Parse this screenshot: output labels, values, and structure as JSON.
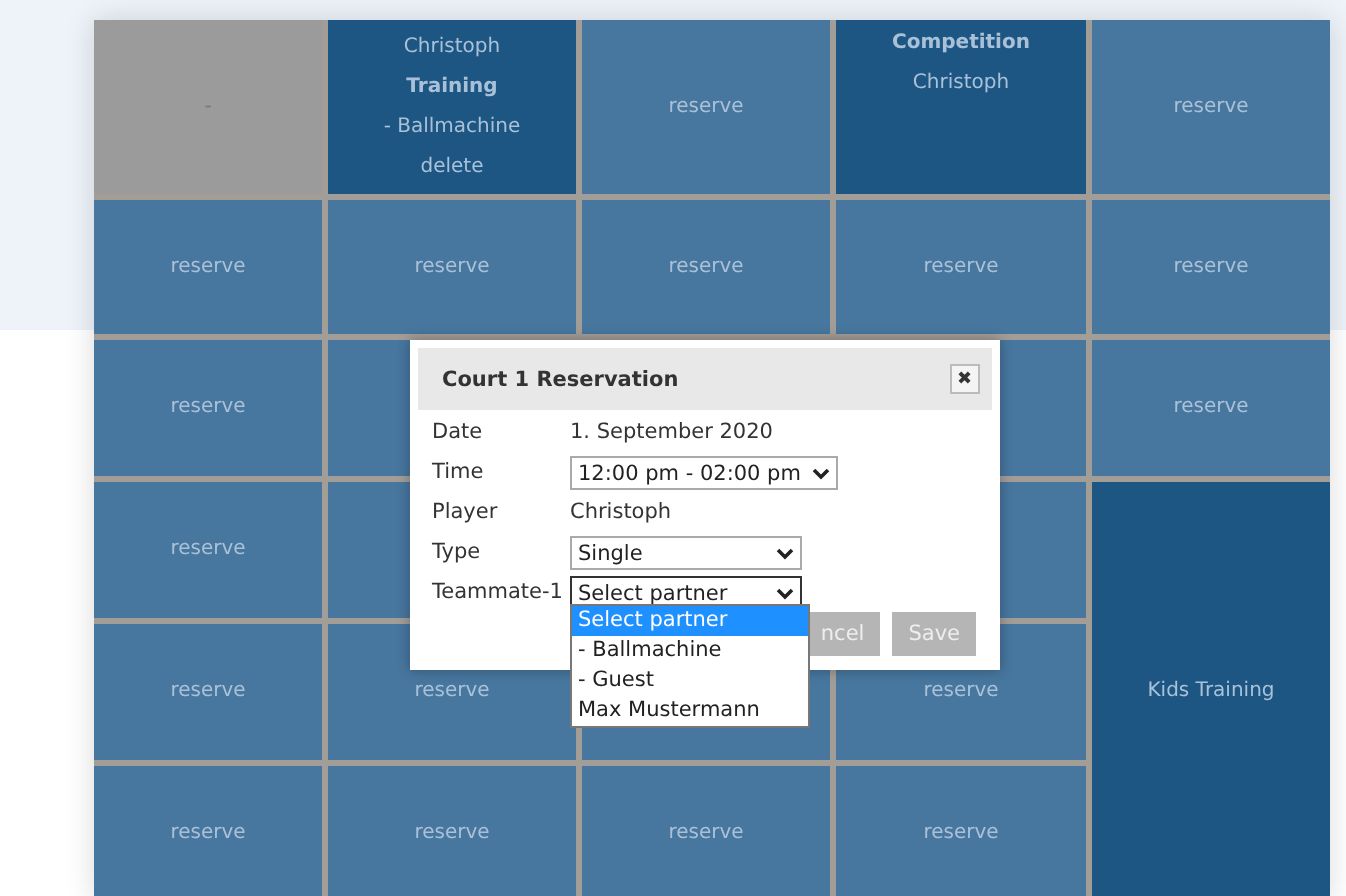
{
  "schedule": {
    "rows": [
      {
        "cells": [
          {
            "kind": "blocked",
            "lines": [
              "-"
            ]
          },
          {
            "kind": "booking",
            "lines": [
              "Christoph",
              "**Training**",
              "- Ballmachine",
              "delete"
            ]
          },
          {
            "kind": "free",
            "lines": [
              "reserve"
            ]
          },
          {
            "kind": "booking",
            "top_aligned": true,
            "lines": [
              "**Competition**",
              "Christoph"
            ]
          },
          {
            "kind": "free",
            "lines": [
              "reserve"
            ]
          }
        ]
      },
      {
        "cells": [
          {
            "kind": "free",
            "lines": [
              "reserve"
            ]
          },
          {
            "kind": "free",
            "lines": [
              "reserve"
            ]
          },
          {
            "kind": "free",
            "lines": [
              "reserve"
            ]
          },
          {
            "kind": "free",
            "lines": [
              "reserve"
            ]
          },
          {
            "kind": "free",
            "lines": [
              "reserve"
            ]
          }
        ]
      },
      {
        "cells": [
          {
            "kind": "free",
            "lines": [
              "reserve"
            ]
          },
          {
            "kind": "free"
          },
          null,
          {
            "kind": "free"
          },
          {
            "kind": "free",
            "lines": [
              "reserve"
            ]
          }
        ]
      },
      {
        "cells": [
          {
            "kind": "free",
            "lines": [
              "reserve"
            ]
          },
          {
            "kind": "free"
          },
          null,
          {
            "kind": "free"
          },
          {
            "kind": "booking",
            "rowspan": 3,
            "lines": [
              "Kids Training"
            ]
          }
        ]
      },
      {
        "cells": [
          {
            "kind": "free",
            "lines": [
              "reserve"
            ]
          },
          {
            "kind": "free",
            "lines": [
              "reserve"
            ]
          },
          {
            "kind": "free"
          },
          {
            "kind": "free",
            "lines": [
              "reserve"
            ]
          }
        ]
      },
      {
        "cells": [
          {
            "kind": "free",
            "lines": [
              "reserve"
            ]
          },
          {
            "kind": "free",
            "lines": [
              "reserve"
            ]
          },
          {
            "kind": "free",
            "lines": [
              "reserve"
            ]
          },
          {
            "kind": "free",
            "lines": [
              "reserve"
            ]
          }
        ]
      }
    ]
  },
  "dialog": {
    "title": "Court 1 Reservation",
    "close": "✖",
    "fields": [
      {
        "kind": "text",
        "label": "Date",
        "value": "1. September 2020"
      },
      {
        "kind": "select",
        "label": "Time",
        "value": "12:00 pm - 02:00 pm"
      },
      {
        "kind": "text",
        "label": "Player",
        "value": "Christoph"
      },
      {
        "kind": "select",
        "label": "Type",
        "value": "Single"
      },
      {
        "kind": "select",
        "label": "Teammate-1",
        "value": "Select partner",
        "expanded": true,
        "options": [
          {
            "label": "Select partner",
            "selected": true
          },
          {
            "label": "- Ballmachine",
            "selected": false
          },
          {
            "label": "- Guest",
            "selected": false
          },
          {
            "label": "Max Mustermann",
            "selected": false
          }
        ]
      }
    ],
    "buttons": [
      "ncel",
      "Save"
    ]
  }
}
